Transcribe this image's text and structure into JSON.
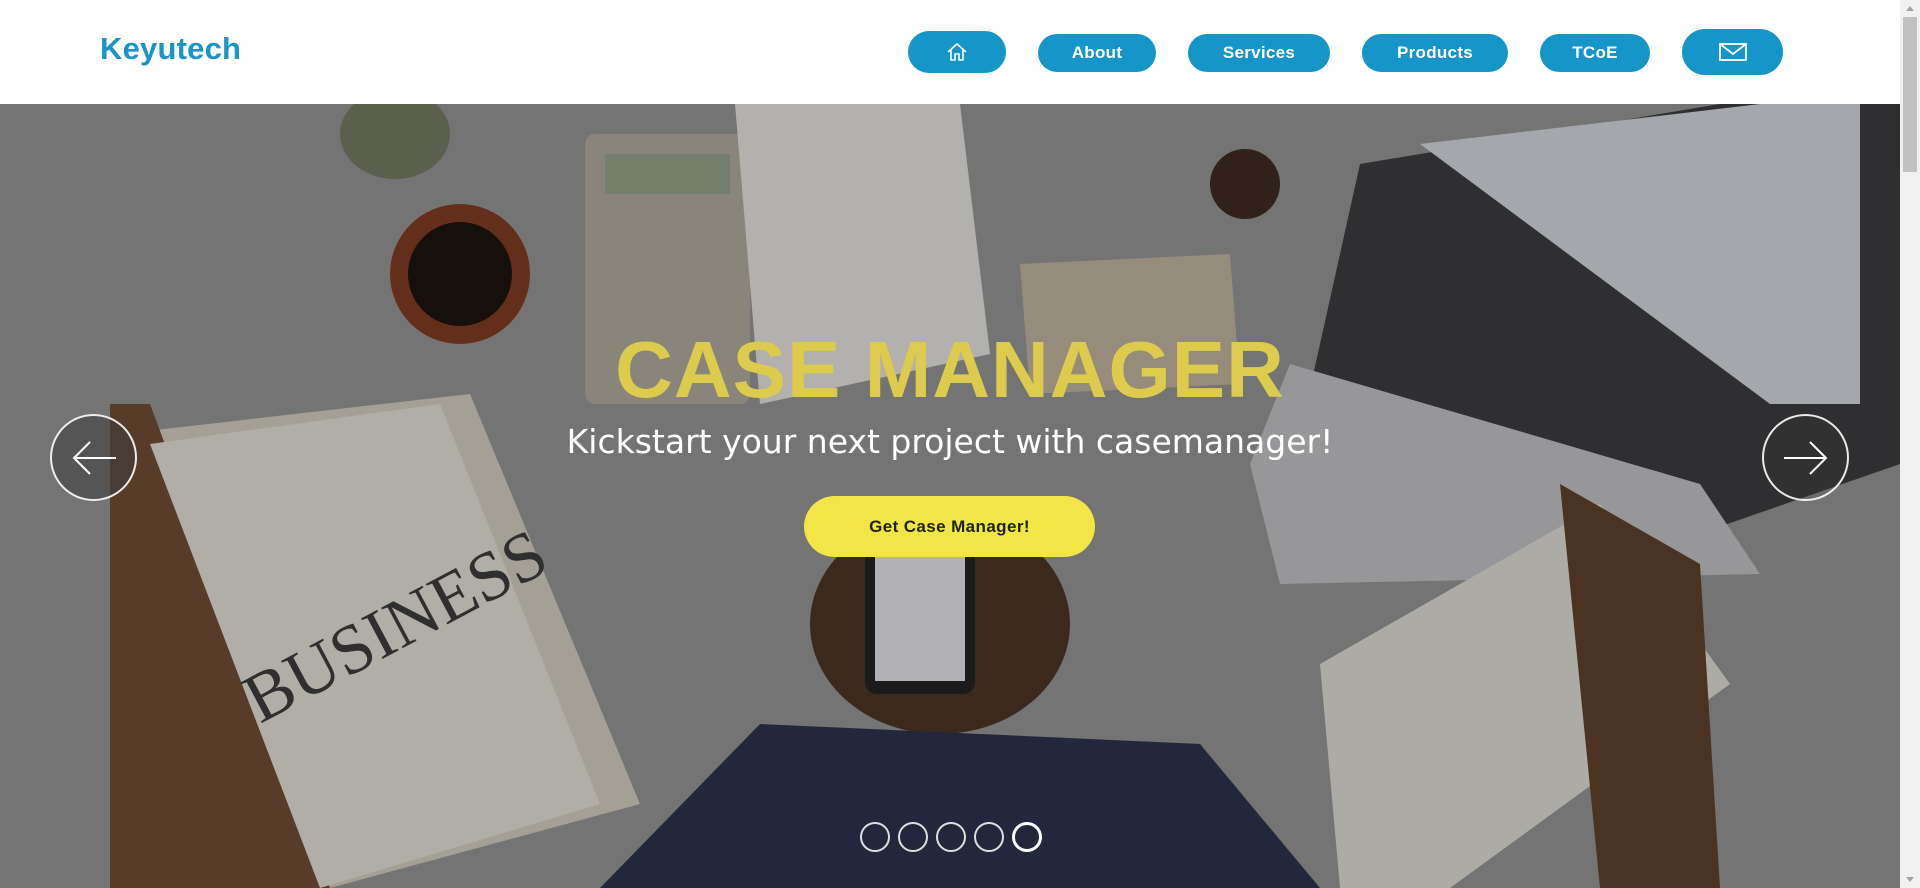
{
  "header": {
    "brand": "Keyutech",
    "nav": [
      {
        "label": "",
        "icon": "home-icon"
      },
      {
        "label": "About"
      },
      {
        "label": "Services"
      },
      {
        "label": "Products"
      },
      {
        "label": "TCoE"
      },
      {
        "label": "",
        "icon": "mail-icon"
      }
    ]
  },
  "hero": {
    "title": "CASE MANAGER",
    "subtitle": "Kickstart your next project with casemanager!",
    "cta_label": "Get Case Manager!",
    "slides_count": 5,
    "active_slide": 5
  },
  "colors": {
    "brand": "#1a94c9",
    "nav_button": "#1695c8",
    "title": "#dccb4c",
    "cta": "#f2e646"
  }
}
